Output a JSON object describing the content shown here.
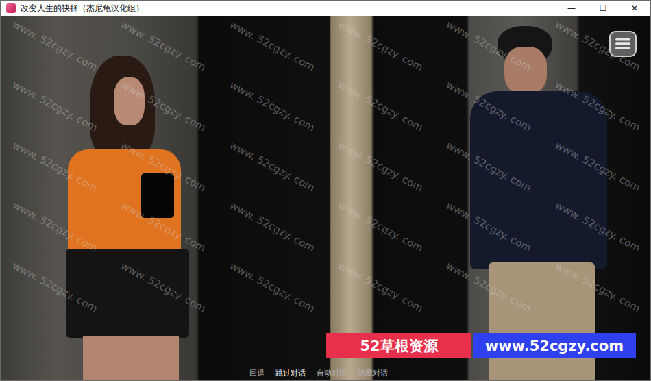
{
  "window": {
    "title": "改变人生的抉择（杰尼龟汉化组）",
    "controls": [
      "—",
      "☐",
      "✕"
    ]
  },
  "quick_menu": [
    {
      "label": "回退",
      "highlighted": false
    },
    {
      "label": "跳过对话",
      "highlighted": true
    },
    {
      "label": "自动对话",
      "highlighted": false
    },
    {
      "label": "隐藏对话",
      "highlighted": false
    }
  ],
  "banner": {
    "left": "52草根资源",
    "right": "www.52cgzy.com"
  },
  "watermark": {
    "text": "www. 52cgzy. com"
  }
}
